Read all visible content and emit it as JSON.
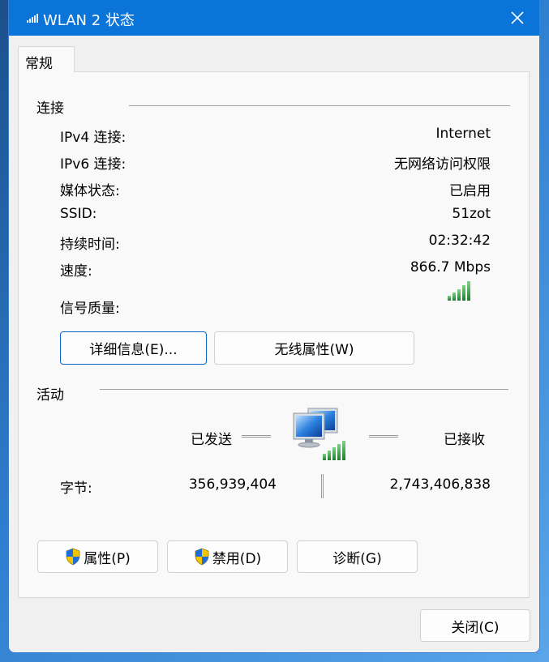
{
  "window": {
    "title": "WLAN 2 状态"
  },
  "tabs": [
    {
      "label": "常规"
    }
  ],
  "connection": {
    "group_title": "连接",
    "rows": [
      {
        "label": "IPv4 连接:",
        "value": "Internet"
      },
      {
        "label": "IPv6 连接:",
        "value": "无网络访问权限"
      },
      {
        "label": "媒体状态:",
        "value": "已启用"
      },
      {
        "label": "SSID:",
        "value": "51zot"
      },
      {
        "label": "持续时间:",
        "value": "02:32:42"
      },
      {
        "label": "速度:",
        "value": "866.7 Mbps"
      }
    ],
    "signal_label": "信号质量:",
    "signal_bars": 5,
    "details_button": "详细信息(E)...",
    "wireless_button": "无线属性(W)"
  },
  "activity": {
    "group_title": "活动",
    "sent_label": "已发送",
    "received_label": "已接收",
    "bytes_label": "字节:",
    "bytes_sent": "356,939,404",
    "bytes_received": "2,743,406,838"
  },
  "buttons": {
    "properties": "属性(P)",
    "disable": "禁用(D)",
    "diagnose": "诊断(G)",
    "close": "关闭(C)"
  },
  "colors": {
    "titlebar": "#0a74d9",
    "signal": "#2e9a3c",
    "accent": "#0a64c8"
  }
}
